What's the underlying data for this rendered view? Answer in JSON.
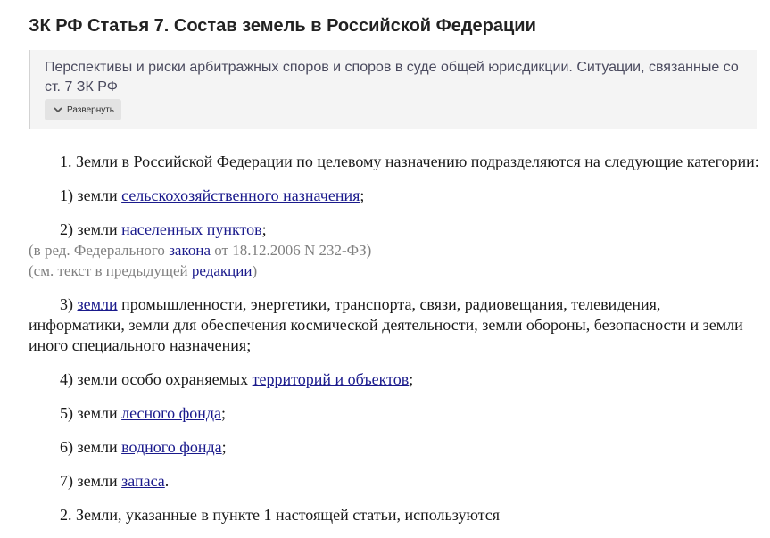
{
  "article": {
    "title": "ЗК РФ Статья 7. Состав земель в Российской Федерации"
  },
  "practice_box": {
    "text": "Перспективы и риски арбитражных споров и споров в суде общей юрисдикции. Ситуации, связанные со ст. 7 ЗК РФ",
    "expand_label": "Развернуть",
    "expand_icon": "chevron-down-icon"
  },
  "body": {
    "p1": "1. Земли в Российской Федерации по целевому назначению подразделяются на следующие категории:",
    "item1": {
      "prefix": "1) земли ",
      "link": "сельскохозяйственного назначения",
      "suffix": ";"
    },
    "item2": {
      "prefix": "2) земли ",
      "link": "населенных пунктов",
      "suffix": ";"
    },
    "note1": {
      "prefix": "(в ред. Федерального ",
      "link": "закона",
      "suffix": " от 18.12.2006 N 232-ФЗ)"
    },
    "note2": {
      "prefix": "(см. текст в предыдущей ",
      "link": "редакции",
      "suffix": ")"
    },
    "item3": {
      "prefix": "3) ",
      "link": "земли",
      "suffix": " промышленности, энергетики, транспорта, связи, радиовещания, телевидения, информатики, земли для обеспечения космической деятельности, земли обороны, безопасности и земли иного специального назначения;"
    },
    "item4": {
      "prefix": "4) земли особо охраняемых ",
      "link": "территорий и объектов",
      "suffix": ";"
    },
    "item5": {
      "prefix": "5) земли ",
      "link": "лесного фонда",
      "suffix": ";"
    },
    "item6": {
      "prefix": "6) земли ",
      "link": "водного фонда",
      "suffix": ";"
    },
    "item7": {
      "prefix": "7) земли ",
      "link": "запаса",
      "suffix": "."
    },
    "p2": "2. Земли, указанные в пункте 1 настоящей статьи, используются"
  },
  "colors": {
    "link": "#1a1a8c",
    "note": "#808080",
    "box_background": "#f4f4f4",
    "button_background": "#e3e3e3"
  }
}
